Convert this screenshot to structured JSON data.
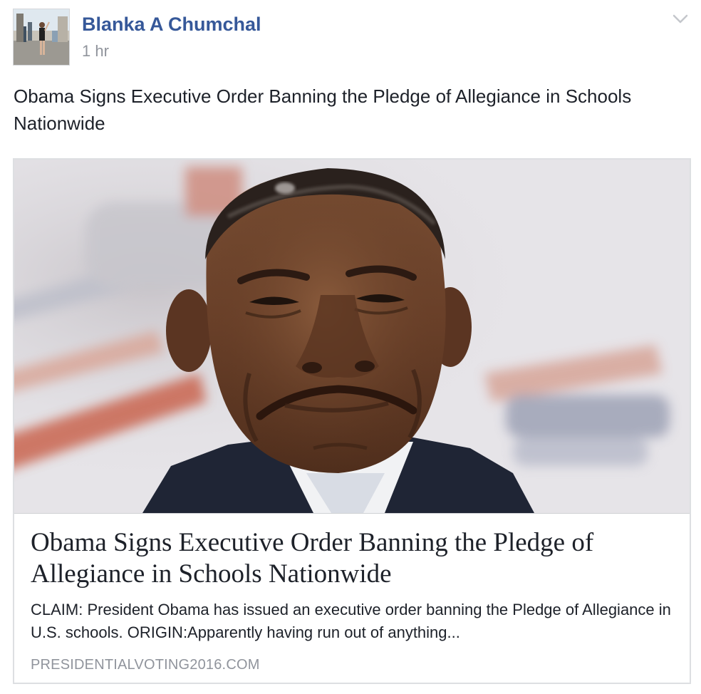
{
  "post": {
    "author": "Blanka A Chumchal",
    "time": "1 hr",
    "text": "Obama Signs Executive Order Banning the Pledge of Allegiance in Schools Nationwide",
    "options_icon": "chevron-down-icon"
  },
  "link_preview": {
    "image_subject": "photo of Barack Obama making a frowning face",
    "title": "Obama Signs Executive Order Banning the Pledge of Allegiance in Schools Nationwide",
    "description": "CLAIM: President Obama has issued an executive order banning the Pledge of Allegiance in U.S. schools. ORIGIN:Apparently having run out of anything...",
    "domain": "PRESIDENTIALVOTING2016.COM"
  },
  "colors": {
    "author_link": "#365899",
    "secondary_text": "#90949c",
    "body_text": "#1d2129",
    "card_border": "#dddfe2"
  }
}
